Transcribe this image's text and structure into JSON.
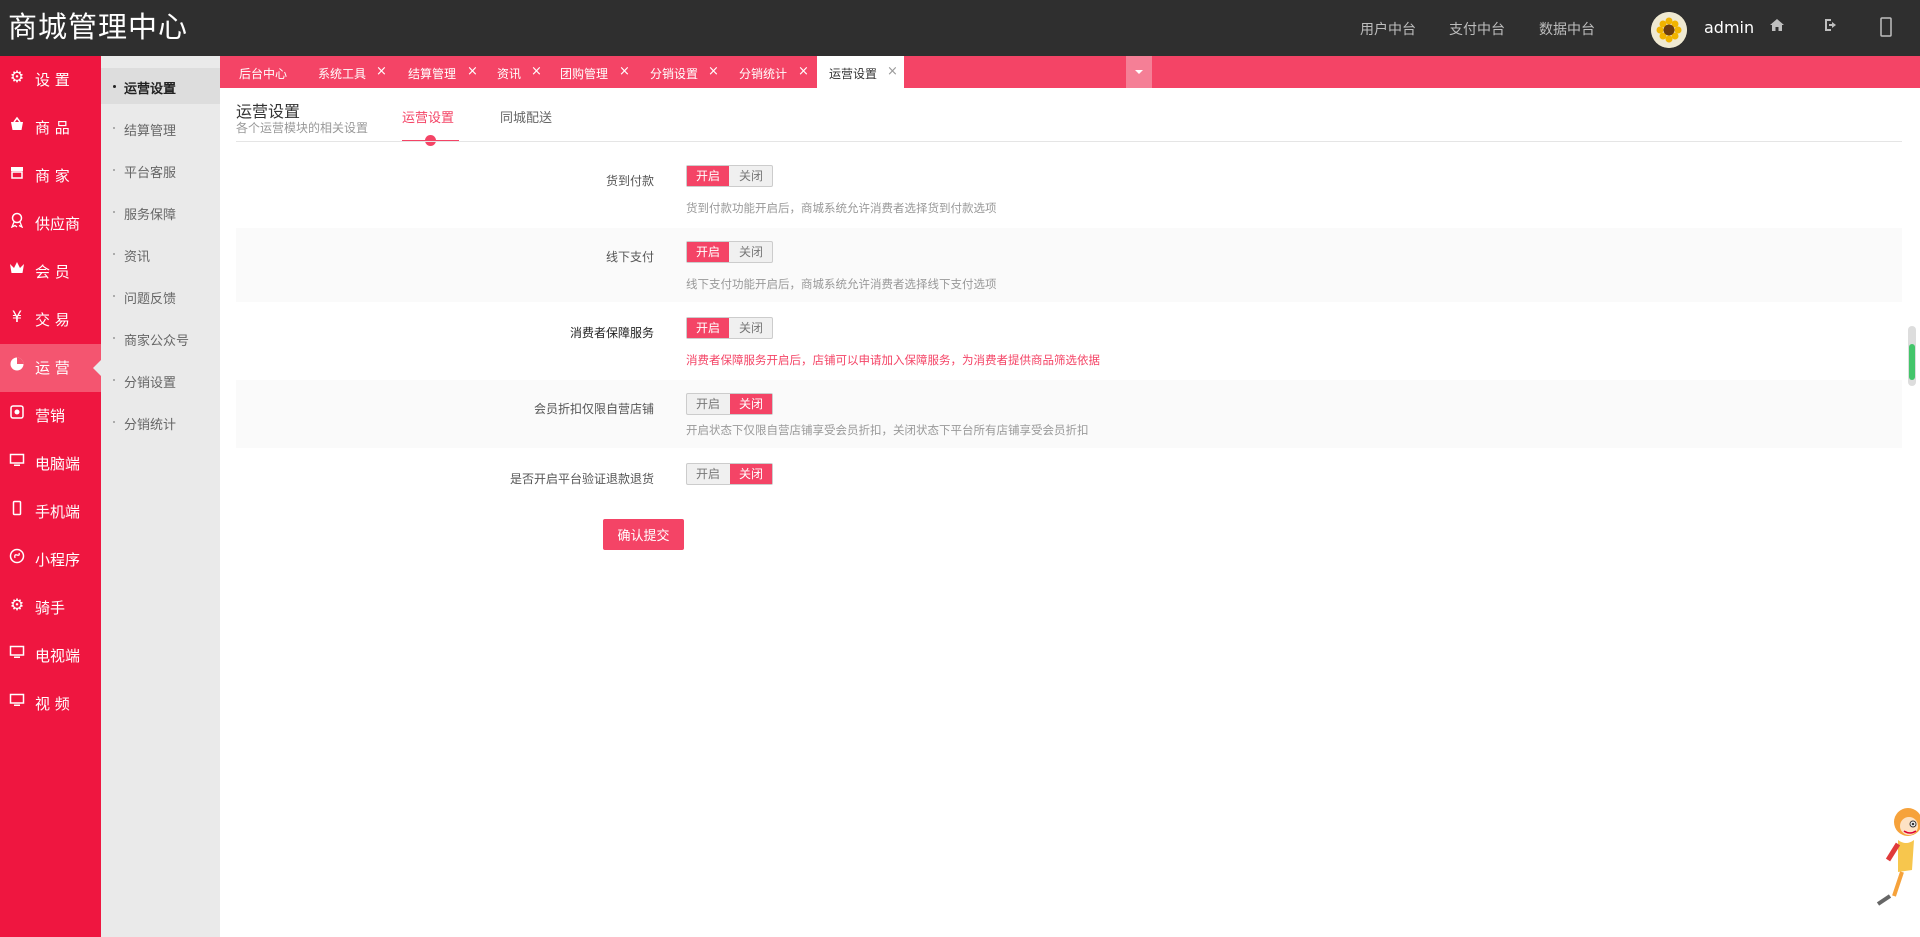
{
  "header": {
    "logo": "商城管理中心",
    "nav": [
      "用户中台",
      "支付中台",
      "数据中台"
    ],
    "username": "admin"
  },
  "sidebar": {
    "items": [
      {
        "label": "设 置",
        "icon": "gear-icon"
      },
      {
        "label": "商 品",
        "icon": "basket-icon"
      },
      {
        "label": "商 家",
        "icon": "store-icon"
      },
      {
        "label": "供应商",
        "icon": "award-icon"
      },
      {
        "label": "会 员",
        "icon": "crown-icon"
      },
      {
        "label": "交 易",
        "icon": "yen-icon"
      },
      {
        "label": "运 营",
        "icon": "pie-chart-icon",
        "active": true
      },
      {
        "label": "营销",
        "icon": "coupon-icon"
      },
      {
        "label": "电脑端",
        "icon": "monitor-icon"
      },
      {
        "label": "手机端",
        "icon": "mobile-icon"
      },
      {
        "label": "小程序",
        "icon": "mini-program-icon"
      },
      {
        "label": "骑手",
        "icon": "gear-icon"
      },
      {
        "label": "电视端",
        "icon": "monitor-icon"
      },
      {
        "label": "视 频",
        "icon": "monitor-icon"
      }
    ]
  },
  "submenu": {
    "items": [
      "运营设置",
      "结算管理",
      "平台客服",
      "服务保障",
      "资讯",
      "问题反馈",
      "商家公众号",
      "分销设置",
      "分销统计"
    ]
  },
  "tabs": [
    {
      "label": "后台中心",
      "closable": false
    },
    {
      "label": "系统工具",
      "closable": true
    },
    {
      "label": "结算管理",
      "closable": true
    },
    {
      "label": "资讯",
      "closable": true
    },
    {
      "label": "团购管理",
      "closable": true
    },
    {
      "label": "分销设置",
      "closable": true
    },
    {
      "label": "分销统计",
      "closable": true
    },
    {
      "label": "运营设置",
      "closable": true,
      "active": true
    }
  ],
  "page": {
    "title": "运营设置",
    "subtitle": "各个运营模块的相关设置",
    "tabs": [
      "运营设置",
      "同城配送"
    ]
  },
  "form": {
    "switch_on": "开启",
    "switch_off": "关闭",
    "rows": [
      {
        "label": "货到付款",
        "value": "on",
        "hint": "货到付款功能开启后，商城系统允许消费者选择货到付款选项"
      },
      {
        "label": "线下支付",
        "value": "on",
        "hint": "线下支付功能开启后，商城系统允许消费者选择线下支付选项"
      },
      {
        "label": "消费者保障服务",
        "value": "on",
        "hint": "消费者保障服务开启后，店铺可以申请加入保障服务，为消费者提供商品筛选依据"
      },
      {
        "label": "会员折扣仅限自营店铺",
        "value": "off",
        "hint": "开启状态下仅限自营店铺享受会员折扣，关闭状态下平台所有店铺享受会员折扣"
      },
      {
        "label": "是否开启平台验证退款退货",
        "value": "off",
        "hint": ""
      }
    ],
    "submit_label": "确认提交"
  },
  "colors": {
    "accent": "#f44466",
    "sidebar": "#ef1640",
    "topbar": "#2f2f2f"
  }
}
